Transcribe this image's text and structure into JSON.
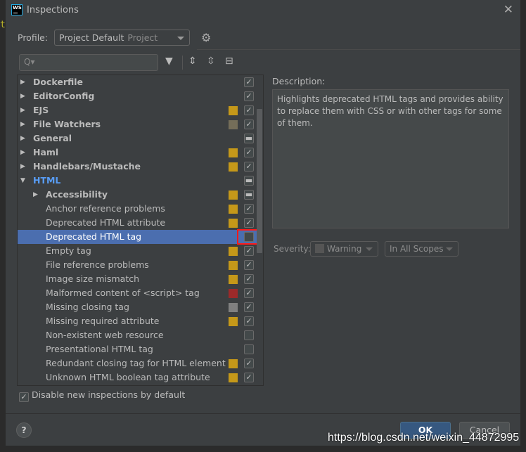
{
  "window": {
    "title": "Inspections",
    "logo_text": "WS",
    "close_icon": "close-icon"
  },
  "editor_fragment": "t",
  "profile": {
    "label": "Profile:",
    "value": "Project Default",
    "scope": "Project"
  },
  "search": {
    "placeholder": "Q▾"
  },
  "toolbar": {
    "icons": [
      "filter-icon",
      "expand-all-icon",
      "collapse-all-icon",
      "reset-icon"
    ]
  },
  "colors": {
    "selection": "#4b6eaf",
    "warning": "#c59819",
    "weak_warning": "#756e59",
    "error": "#9c2a2a",
    "server_problem": "#808080",
    "highlight_box": "#ff1a1a"
  },
  "tree": [
    {
      "label": "Dockerfile",
      "level": 0,
      "arrow": "right",
      "bold": true,
      "severity": null,
      "state": "checked"
    },
    {
      "label": "EditorConfig",
      "level": 0,
      "arrow": "right",
      "bold": true,
      "severity": null,
      "state": "checked"
    },
    {
      "label": "EJS",
      "level": 0,
      "arrow": "right",
      "bold": true,
      "severity": "#c59819",
      "state": "checked"
    },
    {
      "label": "File Watchers",
      "level": 0,
      "arrow": "right",
      "bold": true,
      "severity": "#756e59",
      "state": "checked"
    },
    {
      "label": "General",
      "level": 0,
      "arrow": "right",
      "bold": true,
      "severity": null,
      "state": "mixed"
    },
    {
      "label": "Haml",
      "level": 0,
      "arrow": "right",
      "bold": true,
      "severity": "#c59819",
      "state": "checked"
    },
    {
      "label": "Handlebars/Mustache",
      "level": 0,
      "arrow": "right",
      "bold": true,
      "severity": "#c59819",
      "state": "checked"
    },
    {
      "label": "HTML",
      "level": 0,
      "arrow": "down",
      "bold": true,
      "blue": true,
      "severity": null,
      "state": "mixed"
    },
    {
      "label": "Accessibility",
      "level": 1,
      "arrow": "right",
      "bold": true,
      "severity": "#c59819",
      "state": "mixed"
    },
    {
      "label": "Anchor reference problems",
      "level": 2,
      "severity": "#c59819",
      "state": "checked"
    },
    {
      "label": "Deprecated HTML attribute",
      "level": 2,
      "severity": "#c59819",
      "state": "checked"
    },
    {
      "label": "Deprecated HTML tag",
      "level": 2,
      "severity": null,
      "state": "unchecked",
      "selected": true,
      "highlighted": true
    },
    {
      "label": "Empty tag",
      "level": 2,
      "severity": "#c59819",
      "state": "checked"
    },
    {
      "label": "File reference problems",
      "level": 2,
      "severity": "#c59819",
      "state": "checked"
    },
    {
      "label": "Image size mismatch",
      "level": 2,
      "severity": "#c59819",
      "state": "checked"
    },
    {
      "label": "Malformed content of <script> tag",
      "level": 2,
      "severity": "#9c2a2a",
      "state": "checked"
    },
    {
      "label": "Missing closing tag",
      "level": 2,
      "severity": "#808080",
      "state": "checked"
    },
    {
      "label": "Missing required attribute",
      "level": 2,
      "severity": "#c59819",
      "state": "checked"
    },
    {
      "label": "Non-existent web resource",
      "level": 2,
      "severity": null,
      "state": "unchecked"
    },
    {
      "label": "Presentational HTML tag",
      "level": 2,
      "severity": null,
      "state": "unchecked"
    },
    {
      "label": "Redundant closing tag for HTML element",
      "level": 2,
      "severity": "#c59819",
      "state": "checked"
    },
    {
      "label": "Unknown HTML boolean tag attribute",
      "level": 2,
      "severity": "#c59819",
      "state": "checked"
    }
  ],
  "description": {
    "label": "Description:",
    "text": "Highlights deprecated HTML tags and provides ability to replace them with CSS or with other tags for some of them."
  },
  "severity": {
    "label": "Severity:",
    "value": "Warning",
    "scope": "In All Scopes"
  },
  "footer": {
    "disable_new_label": "Disable new inspections by default",
    "disable_new_checked": true,
    "help": "?",
    "ok": "OK",
    "cancel": "Cancel"
  },
  "watermark": "https://blog.csdn.net/weixin_44872995"
}
